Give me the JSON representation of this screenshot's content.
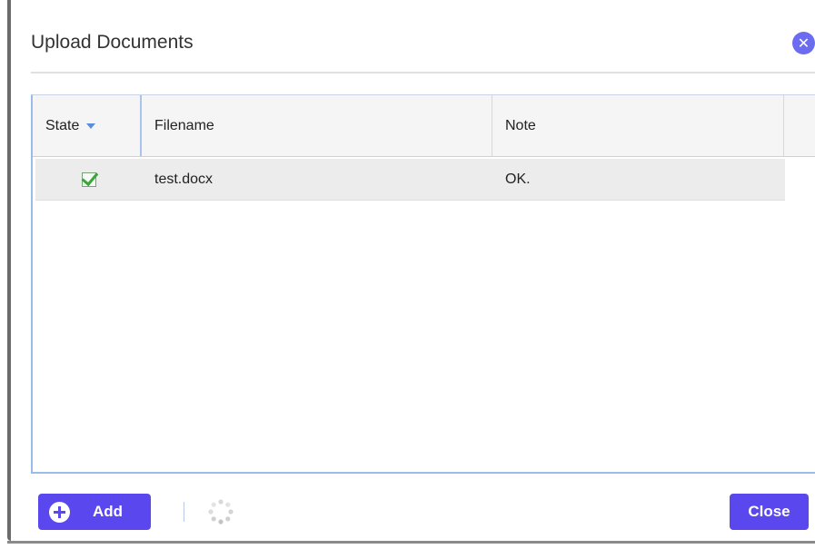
{
  "dialog": {
    "title": "Upload Documents",
    "close_icon": "close-circle-icon"
  },
  "grid": {
    "columns": [
      "State",
      "Filename",
      "Note",
      ""
    ],
    "sort_indicator": "sort-desc-icon",
    "rows": [
      {
        "state_icon": "check-icon",
        "filename": "test.docx",
        "note": "OK."
      }
    ]
  },
  "toolbar": {
    "add_label": "Add",
    "add_icon": "plus-circle-icon",
    "loading_icon": "spinner-icon",
    "close_label": "Close"
  },
  "colors": {
    "accent": "#5b47ee",
    "grid_border": "#99bce8",
    "success": "#3aa53a"
  }
}
